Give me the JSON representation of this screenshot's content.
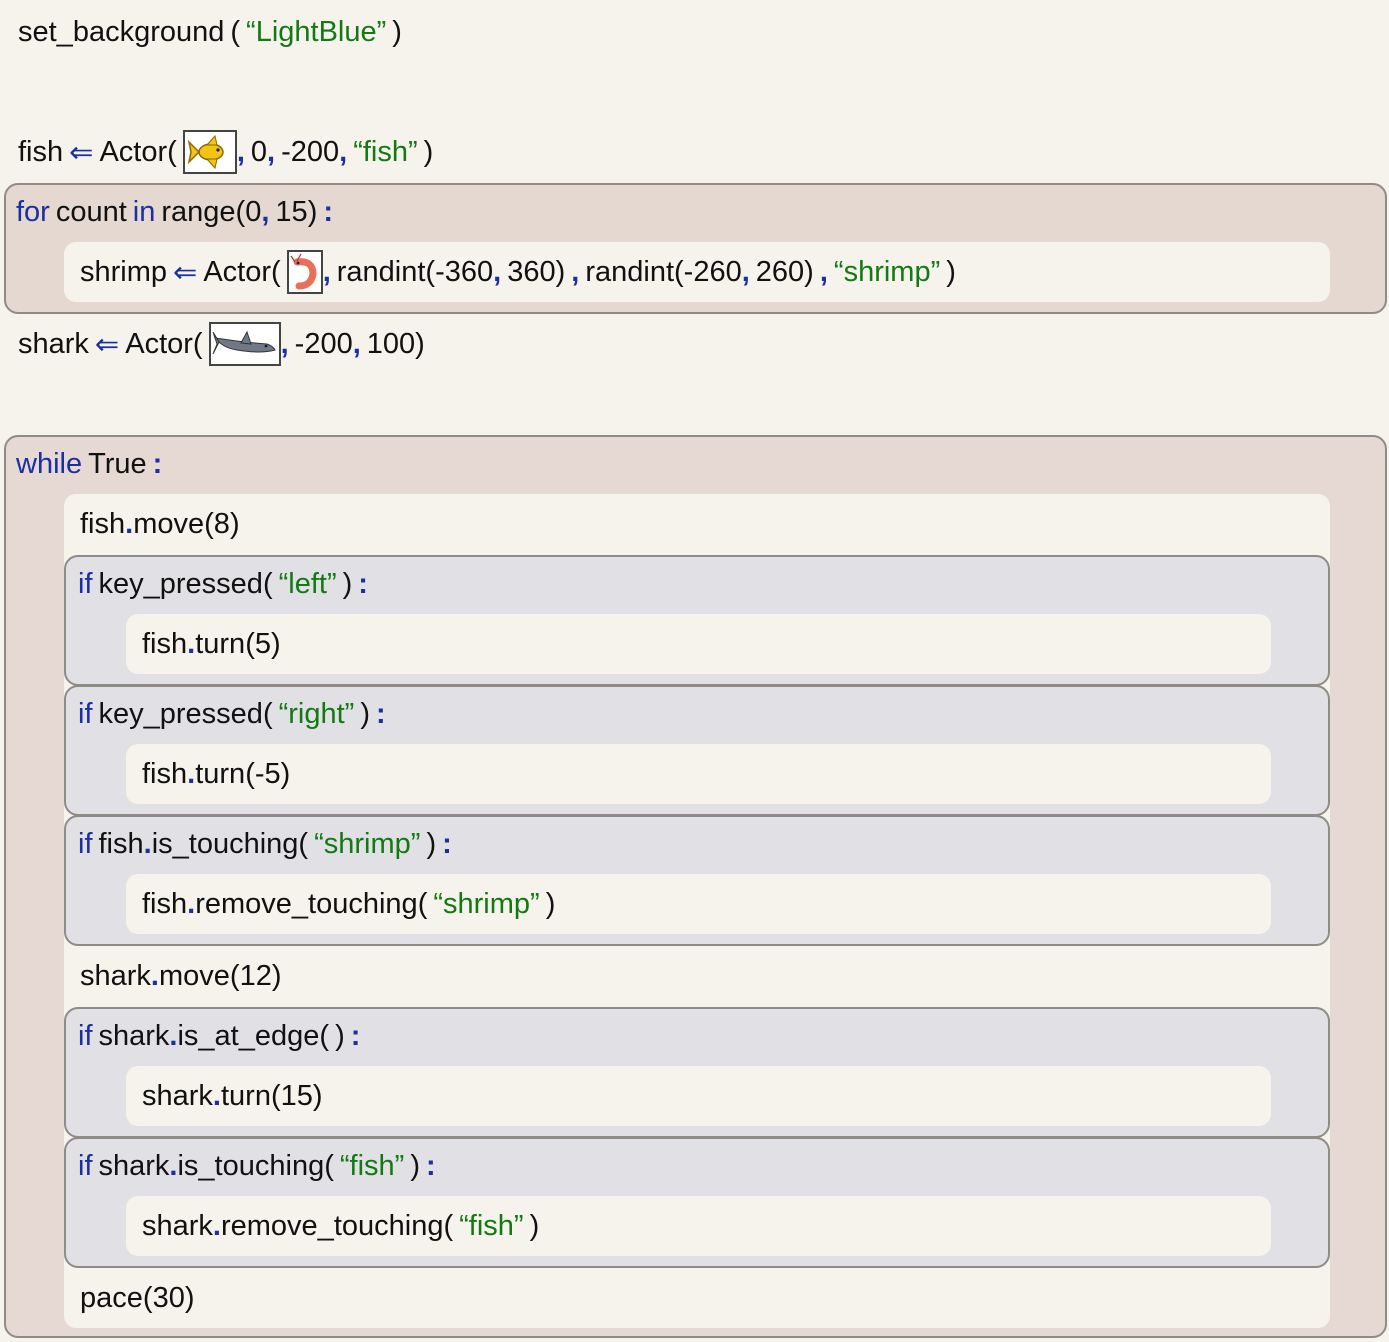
{
  "statements": {
    "set_background": {
      "fn": "set_background",
      "arg": "“LightBlue”"
    },
    "fish_assign": {
      "var": "fish",
      "arrow": "⇐",
      "ctor": "Actor",
      "image_icon": "goldfish-icon",
      "x": "0",
      "y": "-200",
      "name": "“fish”"
    },
    "for_loop": {
      "kw_for": "for",
      "var": "count",
      "kw_in": "in",
      "fn": "range",
      "start": "0",
      "end": "15"
    },
    "shrimp_assign": {
      "var": "shrimp",
      "arrow": "⇐",
      "ctor": "Actor",
      "image_icon": "shrimp-icon",
      "fn_rand1": "randint",
      "r1a": "-360",
      "r1b": "360",
      "fn_rand2": "randint",
      "r2a": "-260",
      "r2b": "260",
      "name": "“shrimp”"
    },
    "shark_assign": {
      "var": "shark",
      "arrow": "⇐",
      "ctor": "Actor",
      "image_icon": "shark-icon",
      "x": "-200",
      "y": "100"
    },
    "while_loop": {
      "kw": "while",
      "cond": "True"
    },
    "fish_move": {
      "obj": "fish",
      "method": "move",
      "arg": "8"
    },
    "if_left": {
      "kw": "if",
      "fn": "key_pressed",
      "arg": "“left”"
    },
    "fish_turn_left": {
      "obj": "fish",
      "method": "turn",
      "arg": "5"
    },
    "if_right": {
      "kw": "if",
      "fn": "key_pressed",
      "arg": "“right”"
    },
    "fish_turn_right": {
      "obj": "fish",
      "method": "turn",
      "arg": "-5"
    },
    "if_fish_touch": {
      "kw": "if",
      "obj": "fish",
      "method": "is_touching",
      "arg": "“shrimp”"
    },
    "fish_remove": {
      "obj": "fish",
      "method": "remove_touching",
      "arg": "“shrimp”"
    },
    "shark_move": {
      "obj": "shark",
      "method": "move",
      "arg": "12"
    },
    "if_shark_edge": {
      "kw": "if",
      "obj": "shark",
      "method": "is_at_edge"
    },
    "shark_turn": {
      "obj": "shark",
      "method": "turn",
      "arg": "15"
    },
    "if_shark_touch": {
      "kw": "if",
      "obj": "shark",
      "method": "is_touching",
      "arg": "“fish”"
    },
    "shark_remove": {
      "obj": "shark",
      "method": "remove_touching",
      "arg": "“fish”"
    },
    "pace": {
      "fn": "pace",
      "arg": "30"
    }
  },
  "colors": {
    "keyword": "#1a2fa0",
    "string": "#137a13",
    "loop_bg": "#e5d8d0",
    "if_bg": "#e1e0e5",
    "body_bg": "#f6f2ec"
  }
}
